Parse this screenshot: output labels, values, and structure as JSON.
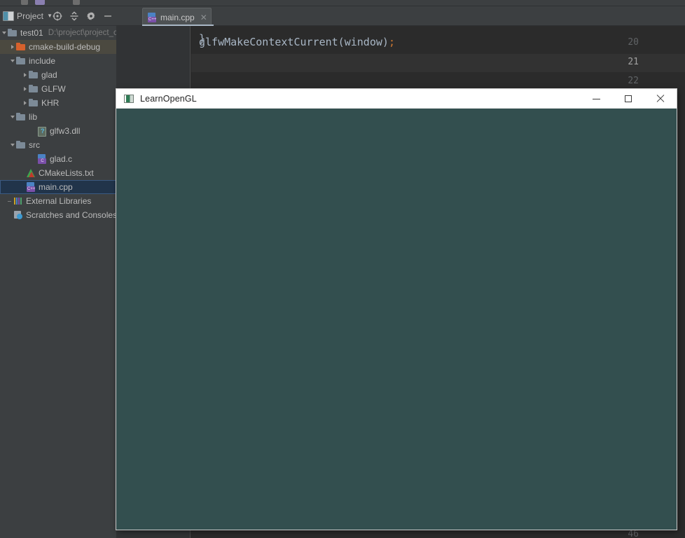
{
  "ide": {
    "project_panel": {
      "title": "Project",
      "caret_icon": "chevron-down-icon",
      "tools": [
        {
          "name": "locate-icon",
          "tooltip": "Select Opened File"
        },
        {
          "name": "collapse-all-icon",
          "tooltip": "Collapse All"
        },
        {
          "name": "gear-icon",
          "tooltip": "Settings"
        },
        {
          "name": "hide-icon",
          "tooltip": "Hide"
        }
      ],
      "tree": [
        {
          "label": "test01",
          "sub": "D:\\project\\project_c+",
          "icon": "folder-icon",
          "indent": 0,
          "arrow": "down",
          "state": "normal"
        },
        {
          "label": "cmake-build-debug",
          "sub": "",
          "icon": "folder-orange-icon",
          "indent": 12,
          "arrow": "right",
          "state": "highlight"
        },
        {
          "label": "include",
          "sub": "",
          "icon": "folder-icon",
          "indent": 12,
          "arrow": "down",
          "state": "normal"
        },
        {
          "label": "glad",
          "sub": "",
          "icon": "folder-icon",
          "indent": 30,
          "arrow": "right",
          "state": "normal"
        },
        {
          "label": "GLFW",
          "sub": "",
          "icon": "folder-icon",
          "indent": 30,
          "arrow": "right",
          "state": "normal"
        },
        {
          "label": "KHR",
          "sub": "",
          "icon": "folder-icon",
          "indent": 30,
          "arrow": "right",
          "state": "normal"
        },
        {
          "label": "lib",
          "sub": "",
          "icon": "folder-icon",
          "indent": 12,
          "arrow": "down",
          "state": "normal"
        },
        {
          "label": "glfw3.dll",
          "sub": "",
          "icon": "dll-file-icon",
          "indent": 42,
          "arrow": "none",
          "state": "normal"
        },
        {
          "label": "src",
          "sub": "",
          "icon": "folder-icon",
          "indent": 12,
          "arrow": "down",
          "state": "normal"
        },
        {
          "label": "glad.c",
          "sub": "",
          "icon": "c-file-icon",
          "indent": 42,
          "arrow": "none",
          "state": "normal",
          "badge": "C"
        },
        {
          "label": "CMakeLists.txt",
          "sub": "",
          "icon": "cmake-file-icon",
          "indent": 26,
          "arrow": "none",
          "state": "normal"
        },
        {
          "label": "main.cpp",
          "sub": "",
          "icon": "cpp-file-icon",
          "indent": 26,
          "arrow": "none",
          "state": "selected",
          "badge": "C++"
        },
        {
          "label": "External Libraries",
          "sub": "",
          "icon": "external-libraries-icon",
          "indent": 8,
          "arrow": "dash",
          "state": "normal"
        },
        {
          "label": "Scratches and Consoles",
          "sub": "",
          "icon": "scratches-icon",
          "indent": 8,
          "arrow": "none",
          "state": "normal"
        }
      ]
    },
    "editor": {
      "tab": {
        "label": "main.cpp",
        "icon": "cpp-file-icon",
        "badge": "C++",
        "close_icon": "close-icon"
      },
      "lines": [
        {
          "number": "",
          "text": "}",
          "current": false,
          "partial": true
        },
        {
          "number": "20",
          "text": "glfwMakeContextCurrent(window);",
          "current": false,
          "partial": false
        },
        {
          "number": "21",
          "text": "",
          "current": true,
          "partial": false
        },
        {
          "number": "22",
          "text": "",
          "current": false,
          "partial": false
        },
        {
          "number": "46",
          "text": "",
          "current": false,
          "partial": false
        }
      ]
    },
    "colors": {
      "panel_background": "#3c3f41",
      "editor_background": "#2b2b2b",
      "gutter_background": "#313335",
      "selection_blue": "#21344a",
      "highlight_row": "#4b4940",
      "code_text": "#a9b7c6",
      "punctuation": "#cc7832"
    }
  },
  "glfw_window": {
    "title": "LearnOpenGL",
    "app_icon": "opengl-window-icon",
    "controls": [
      {
        "name": "minimize-button",
        "glyph": "minimize-icon"
      },
      {
        "name": "maximize-button",
        "glyph": "maximize-icon"
      },
      {
        "name": "close-button",
        "glyph": "close-icon"
      }
    ],
    "viewport_color": "#334f4f",
    "titlebar_color": "#ffffff"
  }
}
